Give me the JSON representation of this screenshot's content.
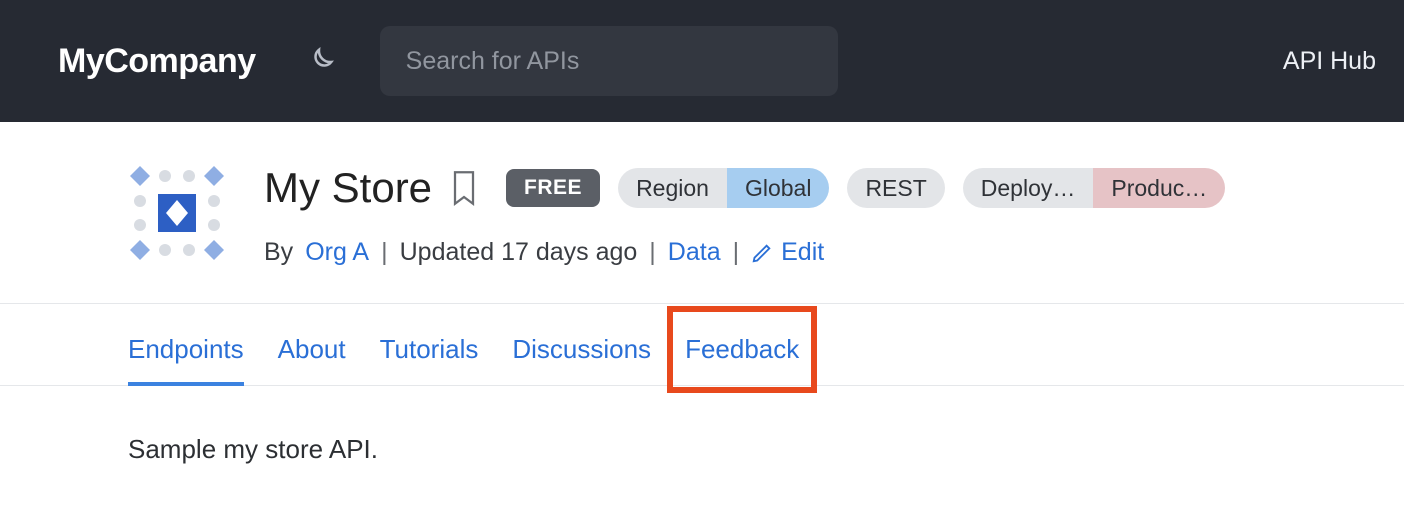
{
  "header": {
    "brand": "MyCompany",
    "search_placeholder": "Search for APIs",
    "right_link": "API Hub"
  },
  "api": {
    "title": "My Store",
    "badge_free": "FREE",
    "region_label": "Region",
    "region_value": "Global",
    "type": "REST",
    "deploy_label": "Deploy…",
    "deploy_value": "Produc…",
    "by_prefix": "By",
    "org": "Org A",
    "updated": "Updated 17 days ago",
    "category": "Data",
    "edit": "Edit"
  },
  "tabs": [
    {
      "label": "Endpoints",
      "active": true
    },
    {
      "label": "About",
      "active": false
    },
    {
      "label": "Tutorials",
      "active": false
    },
    {
      "label": "Discussions",
      "active": false
    },
    {
      "label": "Feedback",
      "active": false,
      "highlighted": true
    }
  ],
  "description": "Sample my store API."
}
